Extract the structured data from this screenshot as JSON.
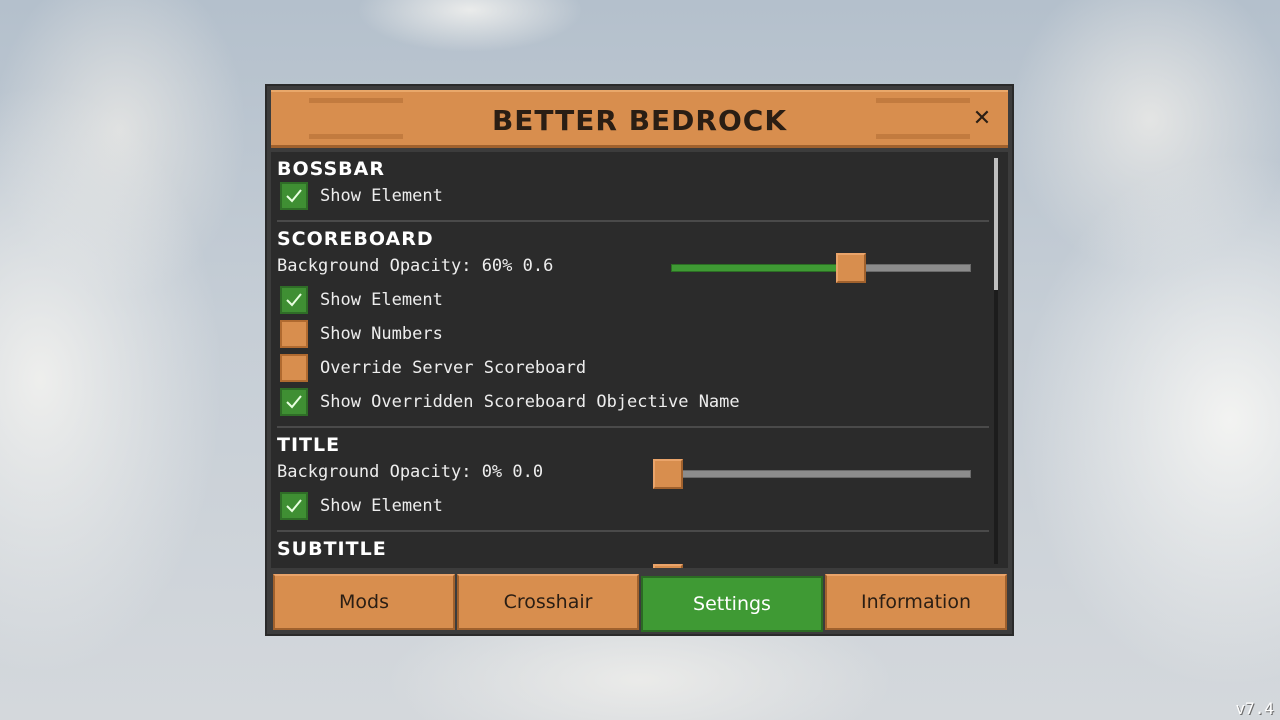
{
  "app": {
    "title": "BETTER BEDROCK",
    "close_label": "✕",
    "version": "v7.4"
  },
  "sections": [
    {
      "title": "BOSSBAR",
      "rows": [
        {
          "type": "checkbox",
          "label": "Show Element",
          "checked": true
        }
      ]
    },
    {
      "title": "SCOREBOARD",
      "rows": [
        {
          "type": "slider",
          "label": "Background Opacity: 60% 0.6",
          "value": 0.6
        },
        {
          "type": "checkbox",
          "label": "Show Element",
          "checked": true
        },
        {
          "type": "checkbox",
          "label": "Show Numbers",
          "checked": false
        },
        {
          "type": "checkbox",
          "label": "Override Server Scoreboard",
          "checked": false
        },
        {
          "type": "checkbox",
          "label": "Show Overridden Scoreboard Objective Name",
          "checked": true
        }
      ]
    },
    {
      "title": "TITLE",
      "rows": [
        {
          "type": "slider",
          "label": "Background Opacity: 0% 0.0",
          "value": 0.0
        },
        {
          "type": "checkbox",
          "label": "Show Element",
          "checked": true
        }
      ]
    },
    {
      "title": "SUBTITLE",
      "rows": []
    }
  ],
  "tabs": [
    {
      "label": "Mods",
      "active": false
    },
    {
      "label": "Crosshair",
      "active": false
    },
    {
      "label": "Settings",
      "active": true
    },
    {
      "label": "Information",
      "active": false
    }
  ],
  "colors": {
    "panel_orange": "#d88e4e",
    "active_green": "#3f9a34",
    "content_bg": "#2b2b2b"
  }
}
